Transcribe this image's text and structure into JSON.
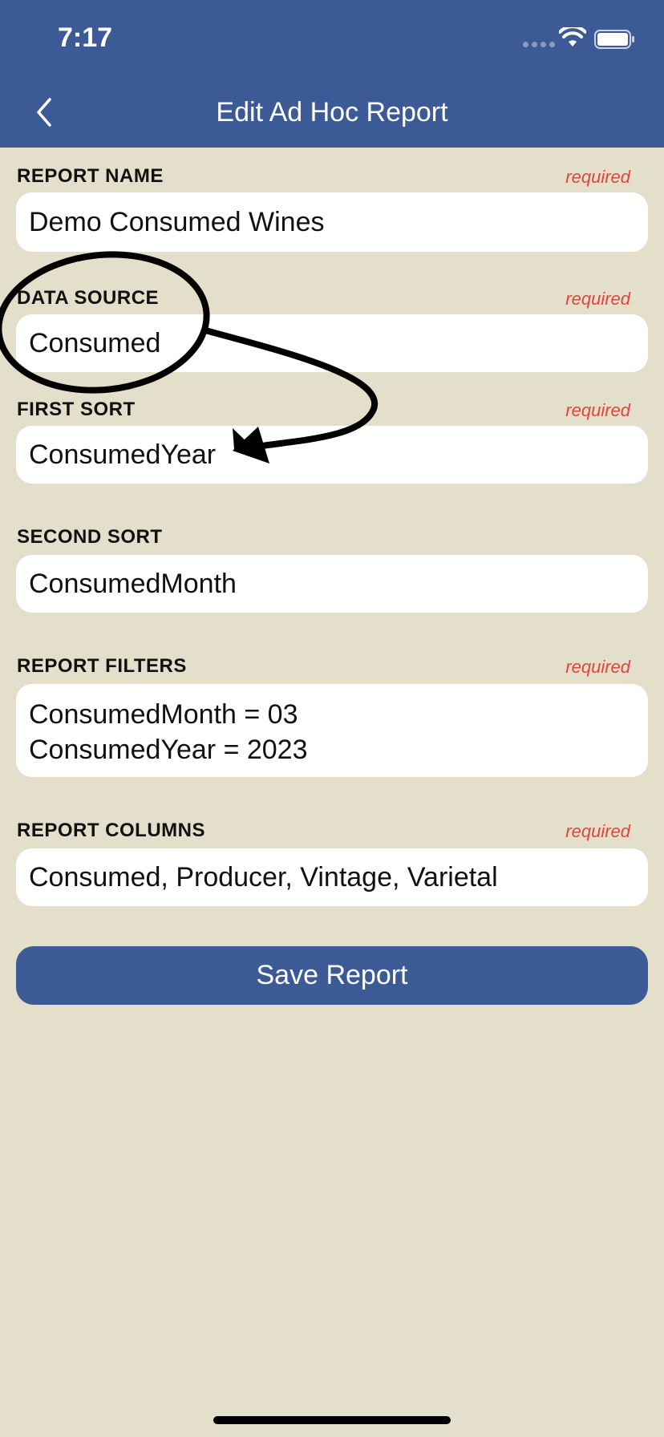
{
  "status_bar": {
    "time": "7:17"
  },
  "nav": {
    "title": "Edit Ad Hoc Report",
    "back_icon": "chevron-left-icon"
  },
  "fields": {
    "report_name": {
      "label": "REPORT NAME",
      "required": "required",
      "value": "Demo Consumed Wines"
    },
    "data_source": {
      "label": "DATA SOURCE",
      "required": "required",
      "value": "Consumed"
    },
    "first_sort": {
      "label": "FIRST SORT",
      "required": "required",
      "value": "ConsumedYear"
    },
    "second_sort": {
      "label": "SECOND SORT",
      "value": "ConsumedMonth"
    },
    "report_filters": {
      "label": "REPORT FILTERS",
      "required": "required",
      "lines": [
        "ConsumedMonth = 03",
        "ConsumedYear = 2023"
      ]
    },
    "report_columns": {
      "label": "REPORT COLUMNS",
      "required": "required",
      "value": "Consumed, Producer, Vintage, Varietal"
    }
  },
  "save_button": {
    "label": "Save Report"
  },
  "colors": {
    "nav": "#3c5a96",
    "background": "#e3dfca",
    "required": "#e0463c",
    "field": "#ffffff"
  }
}
